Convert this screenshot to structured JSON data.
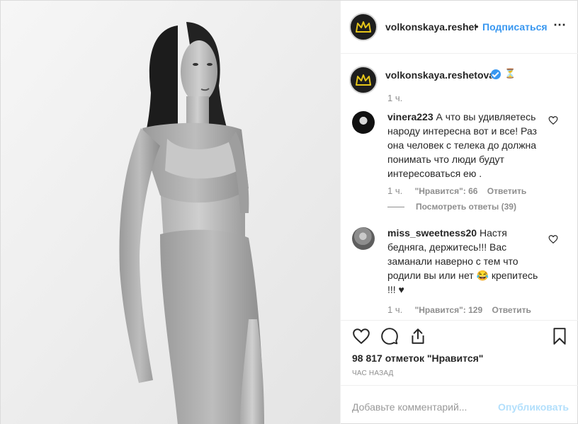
{
  "header": {
    "username": "volkonskaya.reshetova",
    "separator": "•",
    "follow_label": "Подписаться",
    "more_icon": "more-dots-icon"
  },
  "caption": {
    "username": "volkonskaya.reshetova",
    "emoji": "⏳",
    "time": "1 ч."
  },
  "comments": [
    {
      "username": "vinera223",
      "text": "А что вы удивляетесь народу интересна вот и все! Раз она человек с телека до должна понимать что люди будут интересоваться ею .",
      "time": "1 ч.",
      "likes": "\"Нравится\": 66",
      "reply": "Ответить",
      "view_replies": "Посмотреть ответы (39)"
    },
    {
      "username": "miss_sweetness20",
      "text": "Настя бедняга, держитесь!!! Вас заманали наверно с тем что родили вы или нет 😂 крепитесь !!! ♥",
      "time": "1 ч.",
      "likes": "\"Нравится\": 129",
      "reply": "Ответить"
    }
  ],
  "likes_count": "98 817 отметок \"Нравится\"",
  "time_ago": "час назад",
  "add_comment": {
    "placeholder": "Добавьте комментарий...",
    "publish": "Опубликовать"
  },
  "colors": {
    "link_blue": "#3897f0",
    "publish_disabled": "#b2dffc",
    "muted": "#8e8e8e",
    "border": "#efefef",
    "crown_yellow": "#e6c619"
  }
}
